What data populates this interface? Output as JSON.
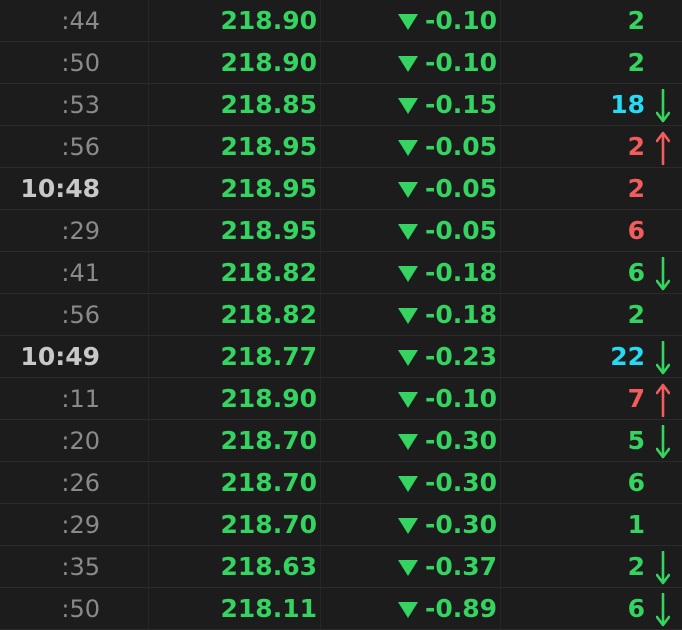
{
  "colors": {
    "background": "#1c1c1c",
    "price_green": "#35d460",
    "size_green": "#35d460",
    "size_cyan": "#27d9f2",
    "size_red": "#f25c5c",
    "time_minor": "#8a8a8a",
    "time_major": "#c8c8c8"
  },
  "rows": [
    {
      "time": ":44",
      "major": false,
      "price": "218.90",
      "change": "-0.10",
      "size": "2",
      "size_color": "green",
      "tick": "none"
    },
    {
      "time": ":50",
      "major": false,
      "price": "218.90",
      "change": "-0.10",
      "size": "2",
      "size_color": "green",
      "tick": "none"
    },
    {
      "time": ":53",
      "major": false,
      "price": "218.85",
      "change": "-0.15",
      "size": "18",
      "size_color": "cyan",
      "tick": "down"
    },
    {
      "time": ":56",
      "major": false,
      "price": "218.95",
      "change": "-0.05",
      "size": "2",
      "size_color": "red",
      "tick": "up"
    },
    {
      "time": "10:48",
      "major": true,
      "price": "218.95",
      "change": "-0.05",
      "size": "2",
      "size_color": "red",
      "tick": "none"
    },
    {
      "time": ":29",
      "major": false,
      "price": "218.95",
      "change": "-0.05",
      "size": "6",
      "size_color": "red",
      "tick": "none"
    },
    {
      "time": ":41",
      "major": false,
      "price": "218.82",
      "change": "-0.18",
      "size": "6",
      "size_color": "green",
      "tick": "down"
    },
    {
      "time": ":56",
      "major": false,
      "price": "218.82",
      "change": "-0.18",
      "size": "2",
      "size_color": "green",
      "tick": "none"
    },
    {
      "time": "10:49",
      "major": true,
      "price": "218.77",
      "change": "-0.23",
      "size": "22",
      "size_color": "cyan",
      "tick": "down"
    },
    {
      "time": ":11",
      "major": false,
      "price": "218.90",
      "change": "-0.10",
      "size": "7",
      "size_color": "red",
      "tick": "up"
    },
    {
      "time": ":20",
      "major": false,
      "price": "218.70",
      "change": "-0.30",
      "size": "5",
      "size_color": "green",
      "tick": "down"
    },
    {
      "time": ":26",
      "major": false,
      "price": "218.70",
      "change": "-0.30",
      "size": "6",
      "size_color": "green",
      "tick": "none"
    },
    {
      "time": ":29",
      "major": false,
      "price": "218.70",
      "change": "-0.30",
      "size": "1",
      "size_color": "green",
      "tick": "none"
    },
    {
      "time": ":35",
      "major": false,
      "price": "218.63",
      "change": "-0.37",
      "size": "2",
      "size_color": "green",
      "tick": "down"
    },
    {
      "time": ":50",
      "major": false,
      "price": "218.11",
      "change": "-0.89",
      "size": "6",
      "size_color": "green",
      "tick": "down"
    }
  ],
  "icons": {
    "change_direction": "triangle-down-icon",
    "tick_down": "arrow-down-icon",
    "tick_up": "arrow-up-icon"
  }
}
